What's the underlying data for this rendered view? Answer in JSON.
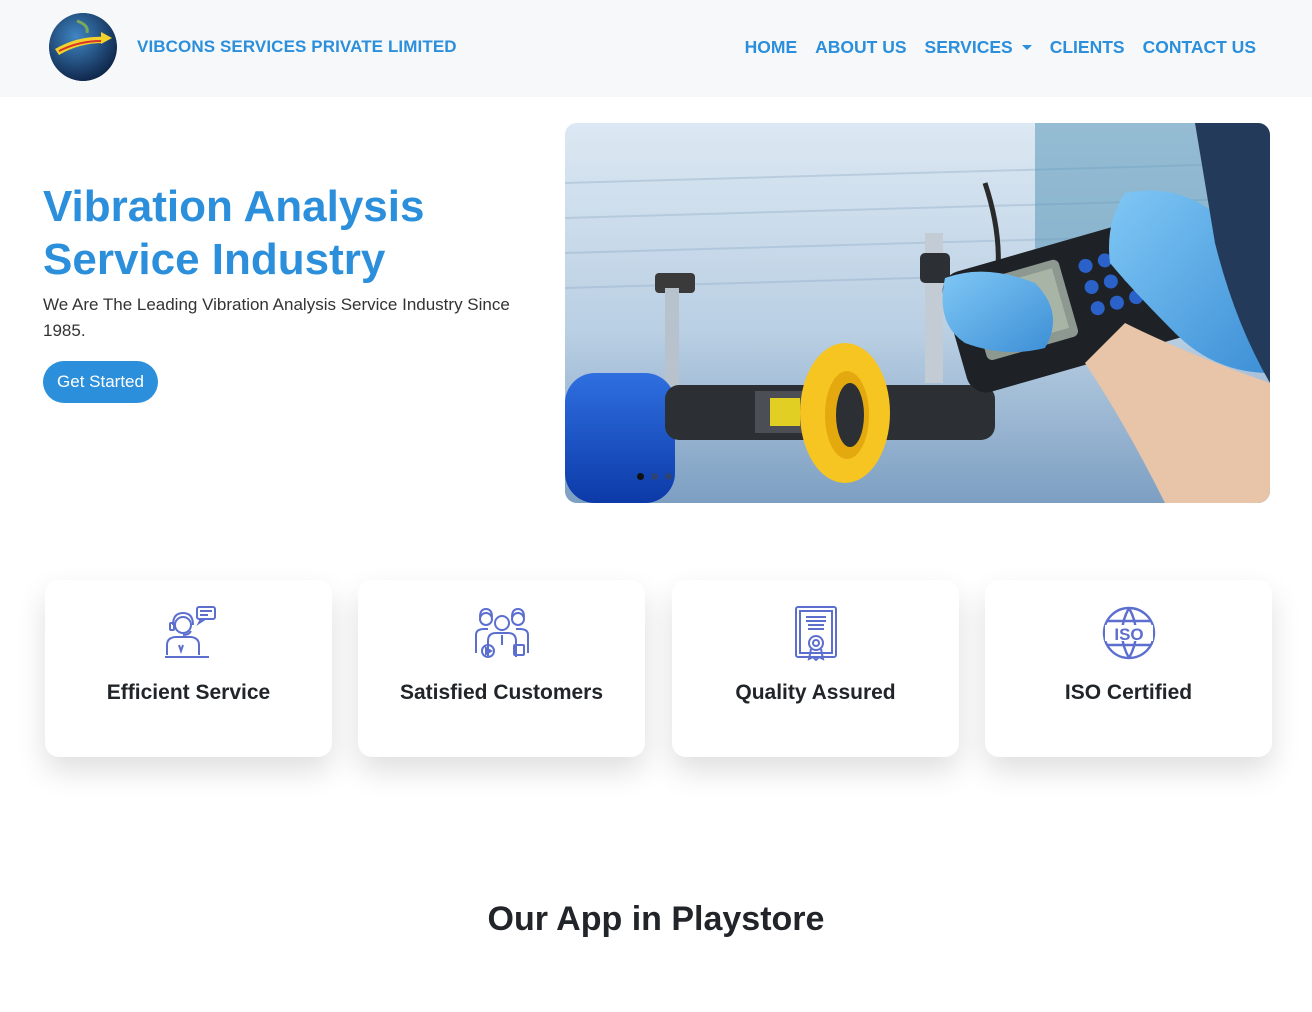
{
  "brand": {
    "name": "VIBCONS SERVICES PRIVATE LIMITED"
  },
  "nav": {
    "items": [
      {
        "label": "HOME"
      },
      {
        "label": "ABOUT US"
      },
      {
        "label": "SERVICES"
      },
      {
        "label": "CLIENTS"
      },
      {
        "label": "CONTACT US"
      }
    ]
  },
  "hero": {
    "title_line1": "Vibration Analysis",
    "title_line2": "Service Industry",
    "subtitle": "We Are The Leading Vibration Analysis Service Industry Since 1985.",
    "cta_label": "Get Started"
  },
  "carousel": {
    "slide_count": 3,
    "active_index": 0
  },
  "features": [
    {
      "label": "Efficient Service",
      "icon": "support-agent-icon"
    },
    {
      "label": "Satisfied Customers",
      "icon": "customers-group-icon"
    },
    {
      "label": "Quality Assured",
      "icon": "certificate-icon"
    },
    {
      "label": "ISO Certified",
      "icon": "iso-globe-icon"
    }
  ],
  "app_section": {
    "title": "Our App in Playstore"
  },
  "colors": {
    "primary": "#2b8fdb",
    "icon_color": "#5c6fcf",
    "navbar_bg": "#f7f8fa"
  }
}
